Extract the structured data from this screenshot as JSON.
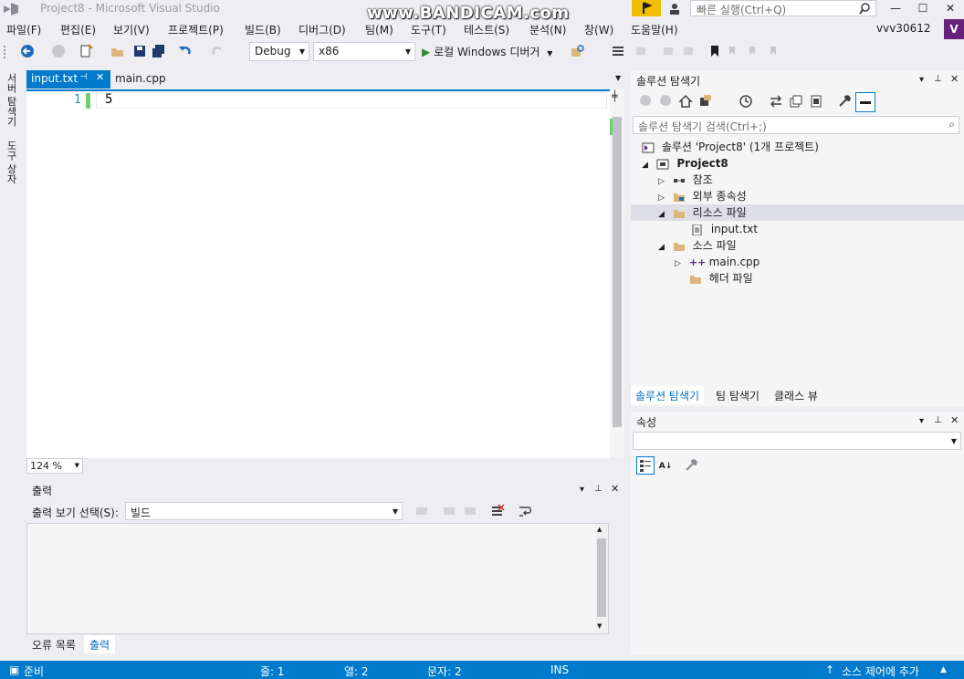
{
  "window": {
    "title": "Project8 - Microsoft Visual Studio",
    "watermark": "www.BANDICAM.com",
    "quick_launch_placeholder": "빠른 실행(Ctrl+Q)",
    "user": "vvv30612",
    "user_badge": "V"
  },
  "menu": [
    "파일(F)",
    "편집(E)",
    "보기(V)",
    "프로젝트(P)",
    "빌드(B)",
    "디버그(D)",
    "팀(M)",
    "도구(T)",
    "테스트(S)",
    "분석(N)",
    "창(W)",
    "도움말(H)"
  ],
  "toolbar": {
    "config": "Debug",
    "platform": "x86",
    "run_label": "로컬 Windows 디버거"
  },
  "left_tabs": [
    "서버 탐색기",
    "도구 상자"
  ],
  "editor": {
    "tabs": [
      {
        "label": "input.txt",
        "active": true
      },
      {
        "label": "main.cpp",
        "active": false
      }
    ],
    "lines": [
      {
        "num": "1",
        "text": "5"
      }
    ],
    "zoom": "124 %"
  },
  "output": {
    "title": "출력",
    "show_label": "출력 보기 선택(S):",
    "selected": "빌드"
  },
  "bottom_tabs": [
    {
      "label": "오류 목록",
      "active": false
    },
    {
      "label": "출력",
      "active": true
    }
  ],
  "solution_explorer": {
    "title": "솔루션 탐색기",
    "search_placeholder": "솔루션 탐색기 검색(Ctrl+;)",
    "tree": [
      {
        "label": "솔루션 'Project8' (1개 프로젝트)",
        "expander": "",
        "icon": "solution-icon"
      },
      {
        "label": "Project8",
        "expander": "◢",
        "icon": "project-icon",
        "bold": true
      },
      {
        "label": "참조",
        "expander": "▷",
        "icon": "references-icon"
      },
      {
        "label": "외부 종속성",
        "expander": "▷",
        "icon": "folder-icon"
      },
      {
        "label": "리소스 파일",
        "expander": "◢",
        "icon": "folder-icon",
        "selected": true
      },
      {
        "label": "input.txt",
        "expander": "",
        "icon": "text-file-icon"
      },
      {
        "label": "소스 파일",
        "expander": "◢",
        "icon": "folder-icon"
      },
      {
        "label": "main.cpp",
        "expander": "▷",
        "icon": "cpp-file-icon"
      },
      {
        "label": "헤더 파일",
        "expander": "",
        "icon": "folder-icon"
      }
    ],
    "tabs": [
      {
        "label": "솔루션 탐색기",
        "active": true
      },
      {
        "label": "팀 탐색기",
        "active": false
      },
      {
        "label": "클래스 뷰",
        "active": false
      }
    ]
  },
  "properties": {
    "title": "속성"
  },
  "status": {
    "ready": "준비",
    "line": "줄: 1",
    "col": "열: 2",
    "char": "문자: 2",
    "mode": "INS",
    "source_control": "소스 제어에 추가"
  }
}
